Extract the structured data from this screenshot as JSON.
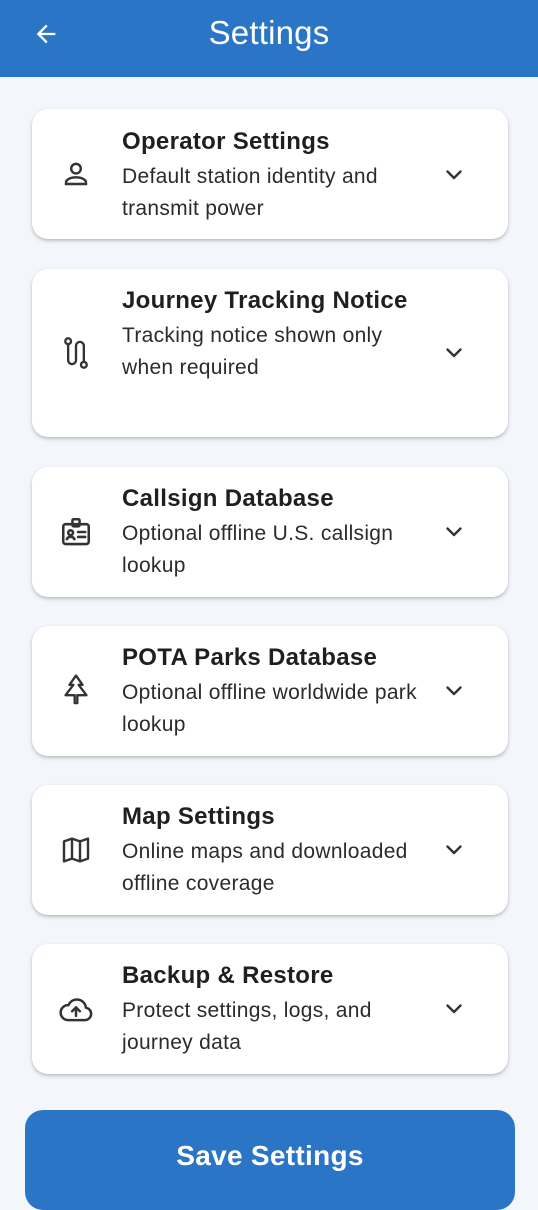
{
  "header": {
    "title": "Settings"
  },
  "sections": [
    {
      "title": "Operator Settings",
      "subtitle": "Default station identity and transmit power",
      "icon": "person-icon"
    },
    {
      "title": "Journey Tracking Notice",
      "subtitle": "Tracking notice shown only when required",
      "icon": "route-icon"
    },
    {
      "title": "Callsign Database",
      "subtitle": "Optional offline U.S. callsign lookup",
      "icon": "badge-icon"
    },
    {
      "title": "POTA Parks Database",
      "subtitle": "Optional offline worldwide park lookup",
      "icon": "tree-icon"
    },
    {
      "title": "Map Settings",
      "subtitle": "Online maps and downloaded offline coverage",
      "icon": "map-icon"
    },
    {
      "title": "Backup & Restore",
      "subtitle": "Protect settings, logs, and journey data",
      "icon": "cloud-upload-icon"
    }
  ],
  "actions": {
    "save_label": "Save Settings"
  },
  "colors": {
    "primary": "#2a75c5",
    "background": "#f3f6fb",
    "card": "#ffffff"
  }
}
